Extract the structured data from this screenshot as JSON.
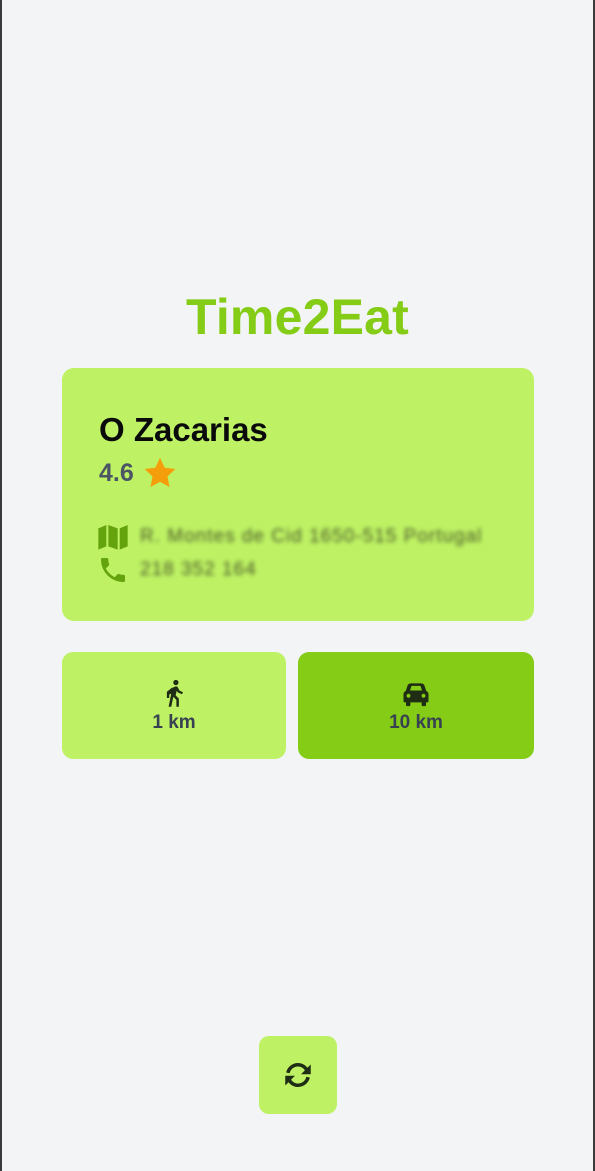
{
  "app": {
    "title": "Time2Eat"
  },
  "restaurant": {
    "name": "O Zacarias",
    "rating": "4.6",
    "address": "R. Montes de Cid 1650-515 Portugal",
    "phone": "218 352 164"
  },
  "travel_modes": [
    {
      "mode": "walking",
      "icon": "walking-person-icon",
      "distance": "1 km",
      "selected": false
    },
    {
      "mode": "driving",
      "icon": "car-icon",
      "distance": "10 km",
      "selected": true
    }
  ],
  "actions": {
    "refresh_icon": "refresh-icon"
  },
  "colors": {
    "brand": "#84cc16",
    "card": "#bef264",
    "background": "#f3f4f6",
    "star": "#f59e0b",
    "icon": "#65a30d"
  }
}
